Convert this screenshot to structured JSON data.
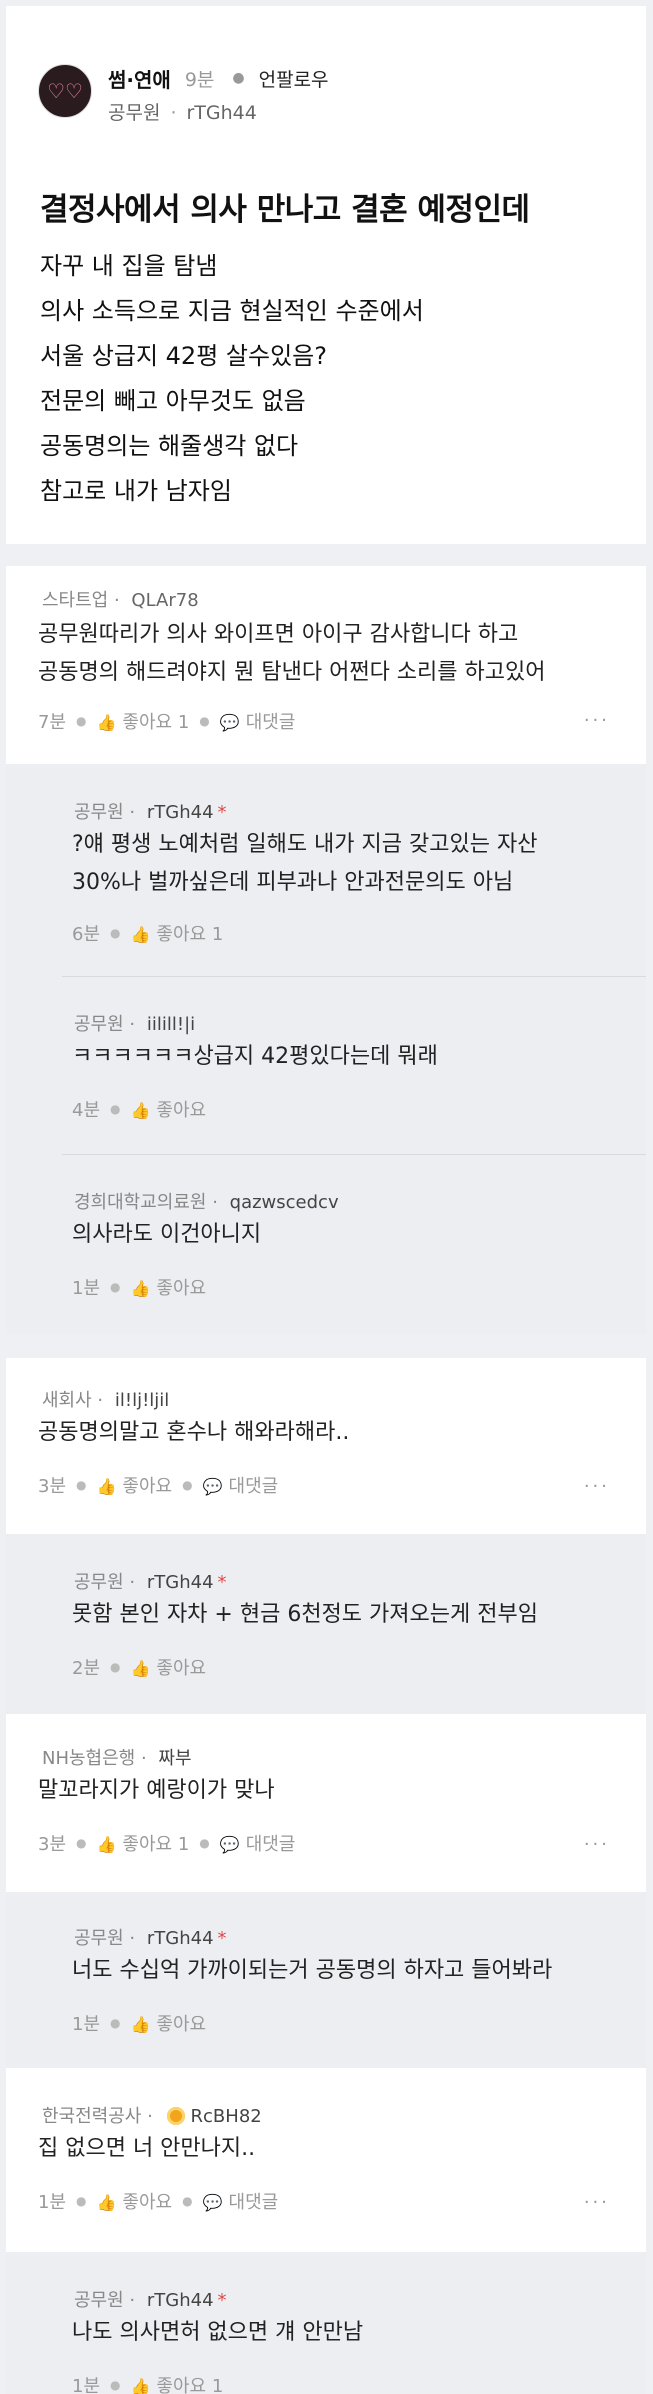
{
  "post": {
    "category": "썸·연애",
    "time": "9분",
    "follow_label": "언팔로우",
    "author_company": "공무원",
    "author_nick": "rTGh44",
    "title": "결정사에서 의사 만나고 결혼 예정인데",
    "body": [
      "자꾸 내 집을 탐냄",
      "의사 소득으로 지금 현실적인 수준에서",
      "서울 상급지 42평 살수있음?",
      "전문의 빼고 아무것도 없음",
      "공동명의는 해줄생각 없다",
      "참고로 내가 남자임"
    ]
  },
  "comments": [
    {
      "company": "스타트업",
      "nick": "QLAr78",
      "lines": [
        "공무원따리가 의사 와이프면 아이구 감사합니다 하고",
        "공동명의 해드려야지 뭔 탐낸다 어쩐다 소리를 하고있어"
      ],
      "time": "7분",
      "like": "좋아요 1",
      "reply": "대댓글",
      "more": "···"
    },
    {
      "company": "공무원",
      "nick": "rTGh44",
      "star": "*",
      "lines": [
        "?얘 평생 노예처럼 일해도 내가 지금 갖고있는 자산",
        "30%나 벌까싶은데 피부과나 안과전문의도 아님"
      ],
      "time": "6분",
      "like": "좋아요 1"
    },
    {
      "company": "공무원",
      "nick": "iilill!|i",
      "lines": [
        "ㅋㅋㅋㅋㅋㅋ상급지 42평있다는데 뭐래"
      ],
      "time": "4분",
      "like": "좋아요"
    },
    {
      "company": "경희대학교의료원",
      "nick": "qazwscedcv",
      "lines": [
        "의사라도 이건아니지"
      ],
      "time": "1분",
      "like": "좋아요"
    },
    {
      "company": "새회사",
      "nick": "il!lj!ljil",
      "lines": [
        "공동명의말고 혼수나 해와라해라.."
      ],
      "time": "3분",
      "like": "좋아요",
      "reply": "대댓글",
      "more": "···"
    },
    {
      "company": "공무원",
      "nick": "rTGh44",
      "star": "*",
      "lines": [
        "못함 본인 자차 + 현금 6천정도 가져오는게 전부임"
      ],
      "time": "2분",
      "like": "좋아요"
    },
    {
      "company": "NH농협은행",
      "nick": "짜부",
      "lines": [
        "말꼬라지가 예랑이가 맞나"
      ],
      "time": "3분",
      "like": "좋아요 1",
      "reply": "대댓글",
      "more": "···"
    },
    {
      "company": "공무원",
      "nick": "rTGh44",
      "star": "*",
      "lines": [
        "너도 수십억 가까이되는거 공동명의 하자고 들어봐라"
      ],
      "time": "1분",
      "like": "좋아요"
    },
    {
      "company": "한국전력공사",
      "nick": "RcBH82",
      "lines": [
        "집 없으면 너 안만나지.."
      ],
      "time": "1분",
      "like": "좋아요",
      "reply": "대댓글",
      "more": "···"
    },
    {
      "company": "공무원",
      "nick": "rTGh44",
      "star": "*",
      "lines": [
        "나도 의사면허 없으면 걔 안만남"
      ],
      "time": "1분",
      "like": "좋아요 1"
    }
  ],
  "icons": {
    "like": "thumbs-up-icon",
    "reply": "speech-bubble-icon",
    "more": "more-dots-icon",
    "emblem": "company-emblem-icon"
  },
  "colors": {
    "star": "#e0484a",
    "reply_bg": "#eceef2",
    "page_bg": "#eef0f3"
  }
}
